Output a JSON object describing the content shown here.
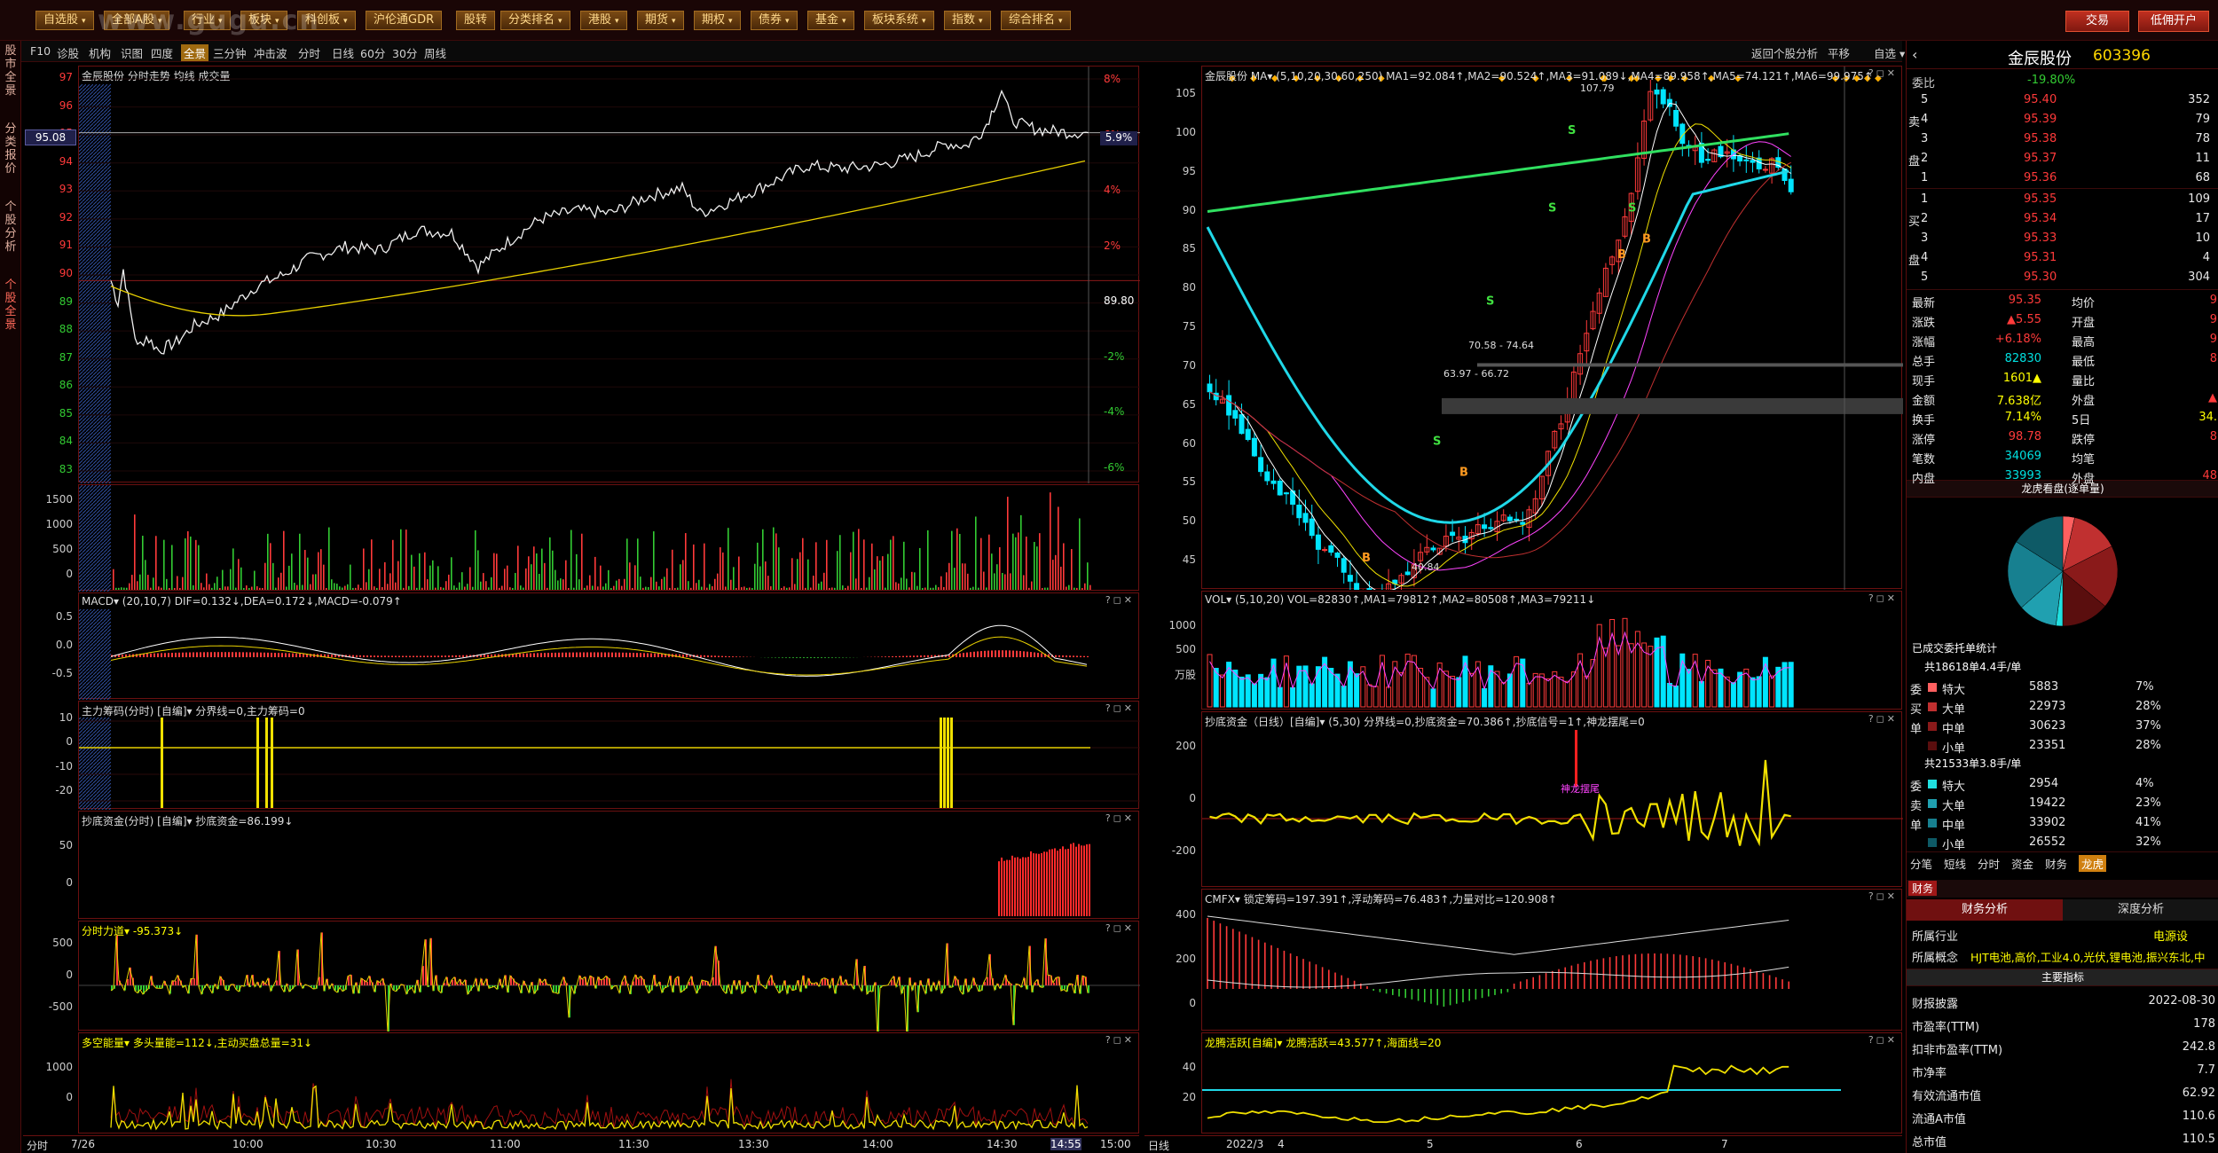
{
  "window": {
    "watermark": "www.gugu.cn"
  },
  "menu": [
    {
      "label": "自选股",
      "dd": true
    },
    {
      "label": "全部A股",
      "dd": true
    },
    {
      "label": "行业",
      "dd": true
    },
    {
      "label": "板块",
      "dd": true
    },
    {
      "label": "科创板",
      "dd": true
    },
    {
      "label": "沪伦通GDR",
      "dd": false
    },
    {
      "label": "股转",
      "dd": false
    },
    {
      "label": "分类排名",
      "dd": true
    },
    {
      "label": "港股",
      "dd": true
    },
    {
      "label": "期货",
      "dd": true
    },
    {
      "label": "期权",
      "dd": true
    },
    {
      "label": "债券",
      "dd": true
    },
    {
      "label": "基金",
      "dd": true
    },
    {
      "label": "板块系统",
      "dd": true
    },
    {
      "label": "指数",
      "dd": true
    },
    {
      "label": "综合排名",
      "dd": true
    }
  ],
  "top_right": {
    "trade": "交易",
    "open_account": "低佣开户"
  },
  "sidebar": [
    "股市全景",
    "分类报价",
    "个股分析",
    "个股全景"
  ],
  "subbar": {
    "left": [
      "F10",
      "诊股",
      "机构",
      "识图",
      "四度",
      "全景",
      "三分钟",
      "冲击波",
      "分时",
      "日线",
      "60分",
      "30分",
      "周线"
    ],
    "active": "全景",
    "right": [
      "返回个股分析",
      "平移",
      "自选"
    ]
  },
  "intraday": {
    "title": "金辰股份 分时走势 均线 成交量",
    "price_label": "95.08",
    "pct_label": "5.9%",
    "y_prices": [
      "97",
      "96",
      "95",
      "94",
      "93",
      "92",
      "91",
      "90",
      "89",
      "88",
      "87",
      "86",
      "85",
      "84",
      "83"
    ],
    "y_pcts": [
      "8%",
      "6%",
      "4%",
      "2%",
      "89.80",
      "-2%",
      "-4%",
      "-6%"
    ],
    "vol_axis": [
      "1500",
      "1000",
      "500",
      "0"
    ],
    "macd_title": "MACD▾ (20,10,7) DIF=0.132↓,DEA=0.172↓,MACD=-0.079↑",
    "macd_axis": [
      "0.5",
      "0.0",
      "-0.5"
    ],
    "zl_title": "主力筹码(分时) [自编]▾ 分界线=0,主力筹码=0",
    "zl_axis": [
      "10",
      "0",
      "-10",
      "-20"
    ],
    "cd_title": "抄底资金(分时) [自编]▾ 抄底资金=86.199↓",
    "cd_axis": [
      "50",
      "0"
    ],
    "fl_title": "分时力道▾ -95.373↓",
    "fl_axis": [
      "500",
      "0",
      "-500"
    ],
    "dk_title": "多空能量▾ 多头量能=112↓,主动买盘总量=31↓",
    "dk_axis": [
      "1000",
      "0"
    ],
    "times": [
      "7/26",
      "10:00",
      "10:30",
      "11:00",
      "11:30",
      "13:30",
      "14:00",
      "14:30",
      "14:55",
      "15:00"
    ],
    "bottom_left": "分时"
  },
  "daily": {
    "title": "金辰股份 MA▾ (5,10,20,30,60,250) MA1=92.084↑,MA2=90.524↑,MA3=91.089↓,MA4=89.958↑,MA5=74.121↑,MA6=99.975↑",
    "y_axis": [
      "105",
      "100",
      "95",
      "90",
      "85",
      "80",
      "75",
      "70",
      "65",
      "60",
      "55",
      "50",
      "45"
    ],
    "hi_label": "107.79",
    "lo_label": "40.84",
    "ann1": "70.58 - 74.64",
    "ann2": "63.97 - 66.72",
    "vol_title": "VOL▾ (5,10,20) VOL=82830↑,MA1=79812↑,MA2=80508↑,MA3=79211↓",
    "vol_axis": [
      "1000",
      "500",
      "万股"
    ],
    "cd_title": "抄底资金（日线）[自编]▾ (5,30) 分界线=0,抄底资金=70.386↑,抄底信号=1↑,神龙摆尾=0",
    "cd_axis": [
      "200",
      "0",
      "-200"
    ],
    "cd_ann": "神龙摆尾",
    "cmfx_title": "CMFX▾ 锁定筹码=197.391↑,浮动筹码=76.483↑,力量对比=120.908↑",
    "cmfx_axis": [
      "400",
      "200",
      "0"
    ],
    "lt_title": "龙腾活跃[自编]▾ 龙腾活跃=43.577↑,海面线=20",
    "lt_axis": [
      "40",
      "20"
    ],
    "months": [
      "2022/3",
      "4",
      "5",
      "6",
      "7"
    ],
    "bottom_left": "日线"
  },
  "quote": {
    "name": "金辰股份",
    "code": "603396",
    "weibi_label": "委比",
    "weibi": "-19.80%",
    "sells": [
      {
        "l": "5",
        "p": "95.40",
        "v": "352"
      },
      {
        "l": "4",
        "p": "95.39",
        "v": "79"
      },
      {
        "l": "3",
        "p": "95.38",
        "v": "78"
      },
      {
        "l": "2",
        "p": "95.37",
        "v": "11"
      },
      {
        "l": "1",
        "p": "95.36",
        "v": "68"
      }
    ],
    "buys": [
      {
        "l": "1",
        "p": "95.35",
        "v": "109"
      },
      {
        "l": "2",
        "p": "95.34",
        "v": "17"
      },
      {
        "l": "3",
        "p": "95.33",
        "v": "10"
      },
      {
        "l": "4",
        "p": "95.31",
        "v": "4"
      },
      {
        "l": "5",
        "p": "95.30",
        "v": "304"
      }
    ],
    "stats": [
      {
        "a": "最新",
        "b": "95.35",
        "c": "均价",
        "d": "9"
      },
      {
        "a": "涨跌",
        "b": "▲5.55",
        "c": "开盘",
        "d": "9"
      },
      {
        "a": "涨幅",
        "b": "+6.18%",
        "c": "最高",
        "d": "9"
      },
      {
        "a": "总手",
        "b": "82830",
        "c": "最低",
        "d": "8"
      },
      {
        "a": "现手",
        "b": "1601▲",
        "c": "量比",
        "d": ""
      },
      {
        "a": "金额",
        "b": "7.638亿",
        "c": "外盘",
        "d": "▲"
      },
      {
        "a": "换手",
        "b": "7.14%",
        "c": "5日",
        "d": "34."
      },
      {
        "a": "涨停",
        "b": "98.78",
        "c": "跌停",
        "d": "8"
      },
      {
        "a": "笔数",
        "b": "34069",
        "c": "均笔",
        "d": ""
      },
      {
        "a": "内盘",
        "b": "33993",
        "c": "外盘",
        "d": "48"
      }
    ],
    "pie_title": "龙虎看盘(逐单量)",
    "entrust_title": "已成交委托单统计",
    "buy_total": "共18618单4.4手/单",
    "buy_rows": [
      {
        "side": "委",
        "name": "特大",
        "v": "5883",
        "p": "7%"
      },
      {
        "side": "买",
        "name": "大单",
        "v": "22973",
        "p": "28%"
      },
      {
        "side": "单",
        "name": "中单",
        "v": "30623",
        "p": "37%"
      },
      {
        "side": "",
        "name": "小单",
        "v": "23351",
        "p": "28%"
      }
    ],
    "sell_total": "共21533单3.8手/单",
    "sell_rows": [
      {
        "side": "委",
        "name": "特大",
        "v": "2954",
        "p": "4%"
      },
      {
        "side": "卖",
        "name": "大单",
        "v": "19422",
        "p": "23%"
      },
      {
        "side": "单",
        "name": "中单",
        "v": "33902",
        "p": "41%"
      },
      {
        "side": "",
        "name": "小单",
        "v": "26552",
        "p": "32%"
      }
    ],
    "tabs": [
      "分笔",
      "短线",
      "分时",
      "资金",
      "财务",
      "龙虎"
    ],
    "active_tab": "龙虎",
    "fin_tab": "财务",
    "fin_sub": [
      "财务分析",
      "深度分析"
    ],
    "industry_label": "所属行业",
    "industry": "电源设",
    "concept_label": "所属概念",
    "concept": "HJT电池,高价,工业4.0,光伏,锂电池,振兴东北,中",
    "main_idx": "主要指标",
    "fin_rows": [
      {
        "a": "财报披露",
        "b": "2022-08-30"
      },
      {
        "a": "市盈率(TTM)",
        "b": "178"
      },
      {
        "a": "扣非市盈率(TTM)",
        "b": "242.8"
      },
      {
        "a": "市净率",
        "b": "7.7"
      },
      {
        "a": "有效流通市值",
        "b": "62.92"
      },
      {
        "a": "流通A市值",
        "b": "110.6"
      },
      {
        "a": "总市值",
        "b": "110.5"
      }
    ]
  },
  "colors": {
    "up": "#ff3a3a",
    "down": "#00e5ff",
    "yellow": "#ffff00",
    "frame": "#6a1010"
  }
}
